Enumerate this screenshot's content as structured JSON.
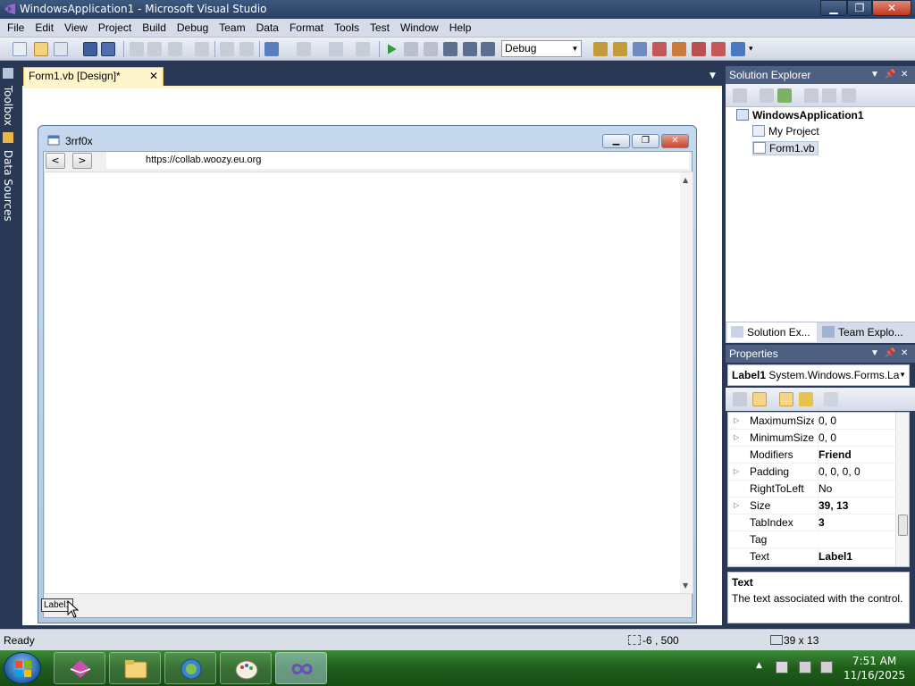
{
  "window": {
    "title": "WindowsApplication1 - Microsoft Visual Studio",
    "min_glyph": "▁",
    "max_glyph": "❐",
    "close_glyph": "✕"
  },
  "menu": [
    "File",
    "Edit",
    "View",
    "Project",
    "Build",
    "Debug",
    "Team",
    "Data",
    "Format",
    "Tools",
    "Test",
    "Window",
    "Help"
  ],
  "toolbar": {
    "configuration": "Debug"
  },
  "left_strip": {
    "toolbox": "Toolbox",
    "data_sources": "Data Sources"
  },
  "editor": {
    "tab_label": "Form1.vb [Design]*",
    "tab_close": "✕"
  },
  "form": {
    "title": "3rrf0x",
    "back_btn": "<",
    "forward_btn": ">",
    "url": "https://collab.woozy.eu.org",
    "label": "Label1"
  },
  "solution_explorer": {
    "title": "Solution Explorer",
    "solution": "WindowsApplication1",
    "items": [
      "My Project",
      "Form1.vb"
    ],
    "tabs": [
      "Solution Ex...",
      "Team Explo..."
    ]
  },
  "properties": {
    "title": "Properties",
    "object_name": "Label1",
    "object_type": "System.Windows.Forms.La",
    "rows": [
      {
        "name": "MaximumSize",
        "value": "0, 0",
        "expand": true,
        "bold": false
      },
      {
        "name": "MinimumSize",
        "value": "0, 0",
        "expand": true,
        "bold": false
      },
      {
        "name": "Modifiers",
        "value": "Friend",
        "expand": false,
        "bold": true
      },
      {
        "name": "Padding",
        "value": "0, 0, 0, 0",
        "expand": true,
        "bold": false
      },
      {
        "name": "RightToLeft",
        "value": "No",
        "expand": false,
        "bold": false
      },
      {
        "name": "Size",
        "value": "39, 13",
        "expand": true,
        "bold": true
      },
      {
        "name": "TabIndex",
        "value": "3",
        "expand": false,
        "bold": true
      },
      {
        "name": "Tag",
        "value": "",
        "expand": false,
        "bold": false
      },
      {
        "name": "Text",
        "value": "Label1",
        "expand": false,
        "bold": true
      }
    ],
    "desc_title": "Text",
    "desc_text": "The text associated with the control."
  },
  "status": {
    "text": "Ready",
    "position": "-6 , 500",
    "size": "39 x 13"
  },
  "taskbar": {
    "time": "7:51 AM",
    "date": "11/16/2025",
    "apps": [
      "visual-studio-ide",
      "file-explorer",
      "browser",
      "paint",
      "visual-studio"
    ]
  },
  "colors": {
    "title_bar": "#2a3f61",
    "taskbar": "#1e5d1a",
    "doc_tab": "#fff5cc"
  }
}
